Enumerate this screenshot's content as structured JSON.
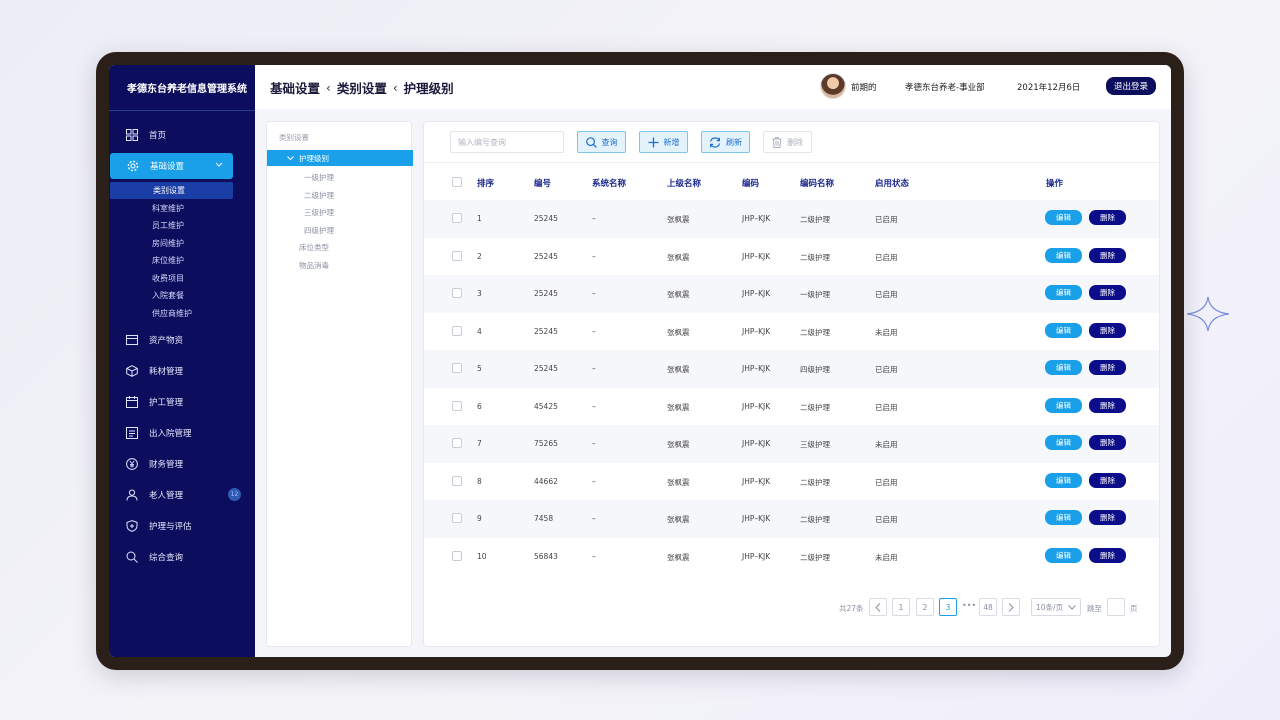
{
  "app": {
    "title": "孝德东台养老信息管理系统"
  },
  "sidebar": {
    "items": [
      {
        "label": "首页",
        "icon": "grid-icon"
      },
      {
        "label": "基础设置",
        "icon": "gear-icon",
        "active": true
      },
      {
        "label": "资产物资",
        "icon": "card-icon"
      },
      {
        "label": "耗材管理",
        "icon": "cube-icon"
      },
      {
        "label": "护工管理",
        "icon": "calendar-icon"
      },
      {
        "label": "出入院管理",
        "icon": "document-icon"
      },
      {
        "label": "财务管理",
        "icon": "yen-icon"
      },
      {
        "label": "老人管理",
        "icon": "person-icon",
        "badge": "12"
      },
      {
        "label": "护理与评估",
        "icon": "shield-icon"
      },
      {
        "label": "综合查询",
        "icon": "search-icon"
      }
    ],
    "sub_items": [
      "类别设置",
      "科室维护",
      "员工维护",
      "房间维护",
      "床位维护",
      "收费项目",
      "入院套餐",
      "供应商维护"
    ]
  },
  "header": {
    "breadcrumb": [
      "基础设置",
      "类别设置",
      "护理级别"
    ],
    "user_name": "前期的",
    "org": "孝德东台养老-事业部",
    "date": "2021年12月6日",
    "logout_label": "退出登录"
  },
  "tree": {
    "title": "类别设置",
    "active_node": "护理级别",
    "children": [
      "一级护理",
      "二级护理",
      "三级护理",
      "四级护理"
    ],
    "siblings": [
      "床位类型",
      "物品消毒"
    ]
  },
  "toolbar": {
    "search_placeholder": "输入编号查询",
    "query_label": "查询",
    "add_label": "新增",
    "refresh_label": "刷新",
    "delete_label": "删除"
  },
  "table": {
    "headers": {
      "order": "排序",
      "code": "编号",
      "sys_name": "系统名称",
      "parent": "上级名称",
      "enc": "编码",
      "enc_name": "编码名称",
      "status": "启用状态",
      "ops": "操作"
    },
    "edit_label": "编辑",
    "delete_label": "删除",
    "rows": [
      {
        "order": "1",
        "code": "25245",
        "sys_name": "–",
        "parent": "张枫震",
        "enc": "JHP–KJK",
        "enc_name": "二级护理",
        "status": "已启用"
      },
      {
        "order": "2",
        "code": "25245",
        "sys_name": "–",
        "parent": "张枫震",
        "enc": "JHP–KJK",
        "enc_name": "二级护理",
        "status": "已启用"
      },
      {
        "order": "3",
        "code": "25245",
        "sys_name": "–",
        "parent": "张枫震",
        "enc": "JHP–KJK",
        "enc_name": "一级护理",
        "status": "已启用"
      },
      {
        "order": "4",
        "code": "25245",
        "sys_name": "–",
        "parent": "张枫震",
        "enc": "JHP–KJK",
        "enc_name": "二级护理",
        "status": "未启用"
      },
      {
        "order": "5",
        "code": "25245",
        "sys_name": "–",
        "parent": "张枫震",
        "enc": "JHP–KJK",
        "enc_name": "四级护理",
        "status": "已启用"
      },
      {
        "order": "6",
        "code": "45425",
        "sys_name": "–",
        "parent": "张枫震",
        "enc": "JHP–KJK",
        "enc_name": "二级护理",
        "status": "已启用"
      },
      {
        "order": "7",
        "code": "75265",
        "sys_name": "–",
        "parent": "张枫震",
        "enc": "JHP–KJK",
        "enc_name": "三级护理",
        "status": "未启用"
      },
      {
        "order": "8",
        "code": "44662",
        "sys_name": "–",
        "parent": "张枫震",
        "enc": "JHP–KJK",
        "enc_name": "二级护理",
        "status": "已启用"
      },
      {
        "order": "9",
        "code": "7458",
        "sys_name": "–",
        "parent": "张枫震",
        "enc": "JHP–KJK",
        "enc_name": "二级护理",
        "status": "已启用"
      },
      {
        "order": "10",
        "code": "56843",
        "sys_name": "–",
        "parent": "张枫震",
        "enc": "JHP–KJK",
        "enc_name": "二级护理",
        "status": "未启用"
      }
    ]
  },
  "pagination": {
    "total": "共27条",
    "pages": [
      "1",
      "2",
      "3",
      "48"
    ],
    "current": "3",
    "ellipsis": "•••",
    "page_size": "10条/页",
    "goto_label": "跳至",
    "page_unit": "页"
  },
  "colors": {
    "sidebar": "#0c0d5c",
    "accent": "#1aa0e8",
    "delete": "#0c0d8a"
  }
}
